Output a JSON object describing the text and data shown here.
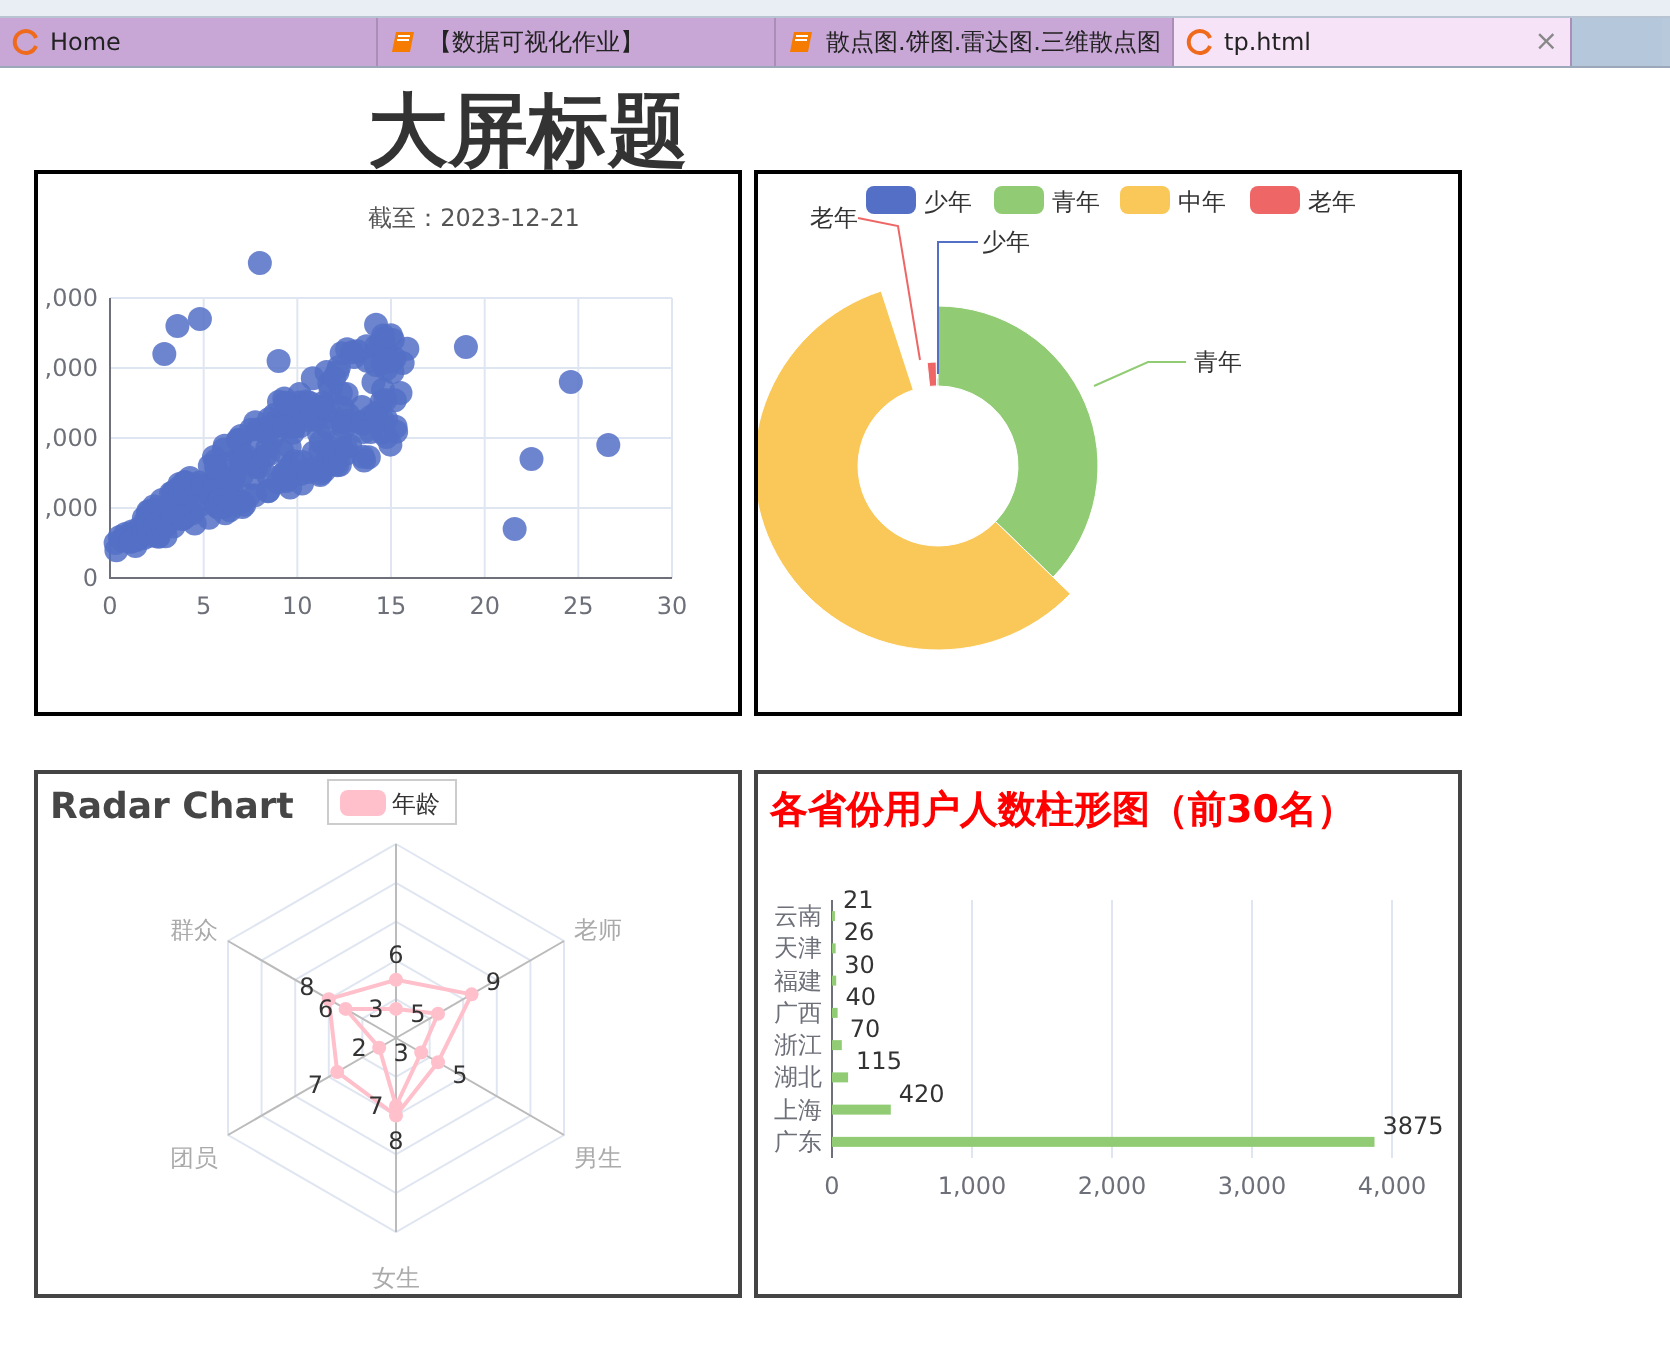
{
  "browser_tabs": [
    {
      "label": "Home",
      "selected": false
    },
    {
      "label": "【数据可视化作业】",
      "selected": false
    },
    {
      "label": "散点图.饼图.雷达图.三维散点图",
      "selected": false
    },
    {
      "label": "tp.html",
      "selected": true,
      "close": "×"
    }
  ],
  "page_title": "大屏标题",
  "scatter": {
    "subtitle": "截至：2023-12-21",
    "y_ticks": [
      ",000",
      ",000",
      ",000",
      ",000",
      "0"
    ],
    "x_ticks": [
      "0",
      "5",
      "10",
      "15",
      "20",
      "25",
      "30"
    ]
  },
  "donut": {
    "legend": [
      {
        "label": "少年",
        "color": "#5470c6"
      },
      {
        "label": "青年",
        "color": "#91cc75"
      },
      {
        "label": "中年",
        "color": "#fac858"
      },
      {
        "label": "老年",
        "color": "#ee6666"
      }
    ],
    "slice_labels": [
      {
        "label": "老年",
        "color": "#ee6666"
      },
      {
        "label": "少年",
        "color": "#5470c6"
      },
      {
        "label": "青年",
        "color": "#91cc75"
      }
    ]
  },
  "radar": {
    "title": "Radar Chart",
    "legend": {
      "label": "年龄",
      "color": "#ffc0cb"
    },
    "axes": [
      "老师",
      "男生",
      "女生",
      "团员",
      "群众"
    ],
    "series": [
      {
        "values": [
          "3",
          "5",
          "3",
          "7",
          "2",
          "6"
        ]
      },
      {
        "values": [
          "6",
          "9",
          "5",
          "8",
          "7",
          "8"
        ]
      }
    ]
  },
  "bars": {
    "title": "各省份用户人数柱形图（前30名）",
    "chart_data": {
      "type": "bar",
      "orientation": "horizontal",
      "categories": [
        "云南",
        "天津",
        "福建",
        "广西",
        "浙江",
        "湖北",
        "上海",
        "广东"
      ],
      "series": [
        {
          "color": "#91cc75",
          "values": [
            21,
            26,
            30,
            40,
            70,
            115,
            420,
            3875
          ]
        }
      ],
      "xlim": [
        0,
        4000
      ],
      "xticks": [
        {
          "value": 0,
          "label": "0"
        },
        {
          "value": 1000,
          "label": "1,000"
        },
        {
          "value": 2000,
          "label": "2,000"
        },
        {
          "value": 3000,
          "label": "3,000"
        },
        {
          "value": 4000,
          "label": "4,000"
        }
      ],
      "grid": true,
      "data_labels": true
    }
  }
}
